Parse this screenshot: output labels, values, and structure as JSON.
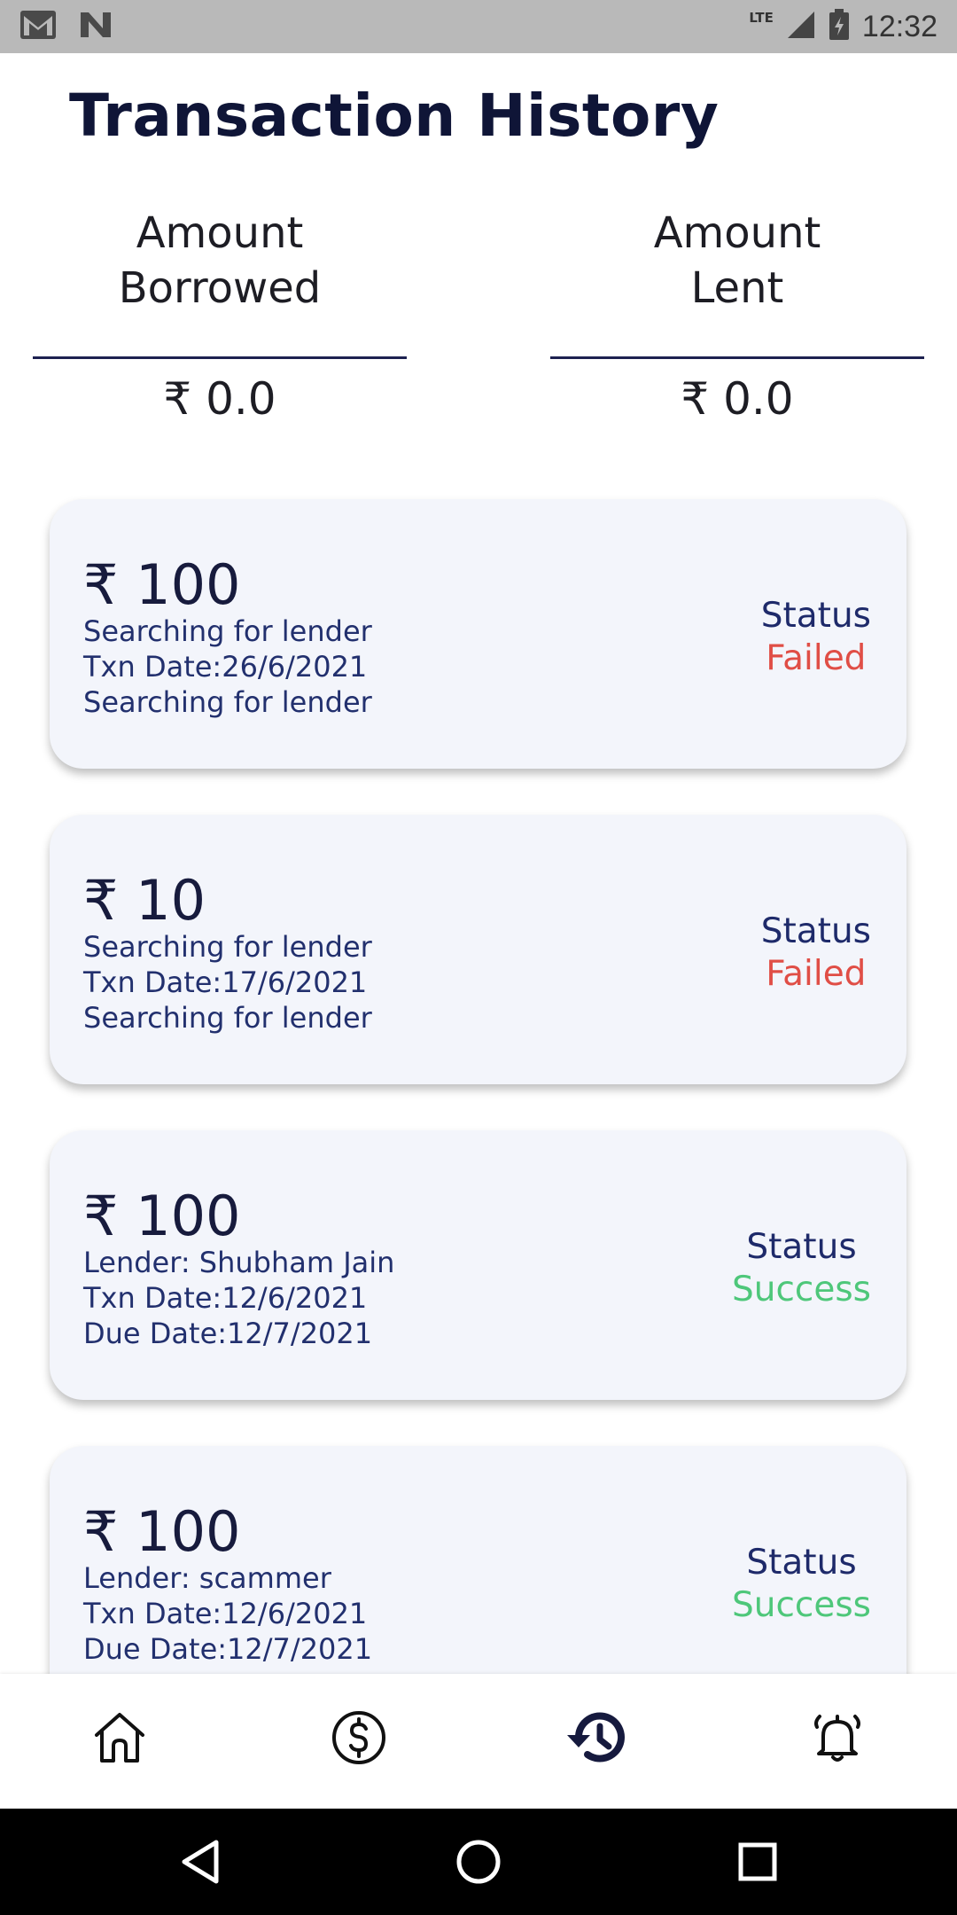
{
  "status_bar": {
    "time": "12:32",
    "network": "LTE"
  },
  "header": {
    "title": "Transaction History"
  },
  "summary": {
    "borrowed": {
      "label_line1": "Amount",
      "label_line2": "Borrowed",
      "value": "₹ 0.0"
    },
    "lent": {
      "label_line1": "Amount",
      "label_line2": "Lent",
      "value": "₹ 0.0"
    }
  },
  "transactions": [
    {
      "amount": "₹ 100",
      "line1": "Searching for lender",
      "line2": "Txn Date:26/6/2021",
      "line3": "Searching for lender",
      "status_label": "Status",
      "status": "Failed"
    },
    {
      "amount": "₹ 10",
      "line1": "Searching for lender",
      "line2": "Txn Date:17/6/2021",
      "line3": "Searching for lender",
      "status_label": "Status",
      "status": "Failed"
    },
    {
      "amount": "₹ 100",
      "line1": "Lender: Shubham Jain",
      "line2": "Txn Date:12/6/2021",
      "line3": "Due Date:12/7/2021",
      "status_label": "Status",
      "status": "Success"
    },
    {
      "amount": "₹ 100",
      "line1": "Lender: scammer",
      "line2": "Txn Date:12/6/2021",
      "line3": "Due Date:12/7/2021",
      "status_label": "Status",
      "status": "Success"
    }
  ],
  "bottom_nav": {
    "items": [
      {
        "icon": "home-icon",
        "active": false
      },
      {
        "icon": "dollar-circle-icon",
        "active": false
      },
      {
        "icon": "history-icon",
        "active": true
      },
      {
        "icon": "bell-icon",
        "active": false
      }
    ]
  },
  "colors": {
    "failed": "#e04e46",
    "success": "#4ec77a",
    "card_bg": "#f3f5fb",
    "title": "#0f1537"
  }
}
